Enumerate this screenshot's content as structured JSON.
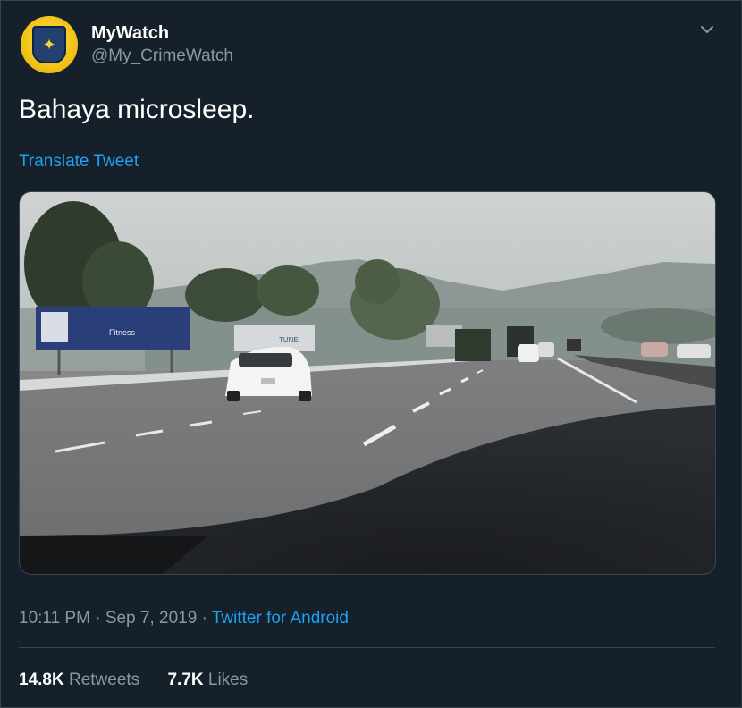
{
  "user": {
    "display_name": "MyWatch",
    "handle": "@My_CrimeWatch",
    "avatar_icon": "police-badge-icon"
  },
  "tweet": {
    "text": "Bahaya microsleep.",
    "translate_label": "Translate Tweet",
    "time": "10:11 PM",
    "separator": "·",
    "date": "Sep 7, 2019",
    "source": "Twitter for Android"
  },
  "media": {
    "kind": "video",
    "billboard_text_1": "Fitness",
    "billboard_text_2": "TUNE"
  },
  "stats": {
    "retweets_count": "14.8K",
    "retweets_label": "Retweets",
    "likes_count": "7.7K",
    "likes_label": "Likes"
  },
  "colors": {
    "background": "#15202b",
    "accent": "#1da1f2",
    "secondary_text": "#8899a6",
    "border": "#38444d"
  }
}
